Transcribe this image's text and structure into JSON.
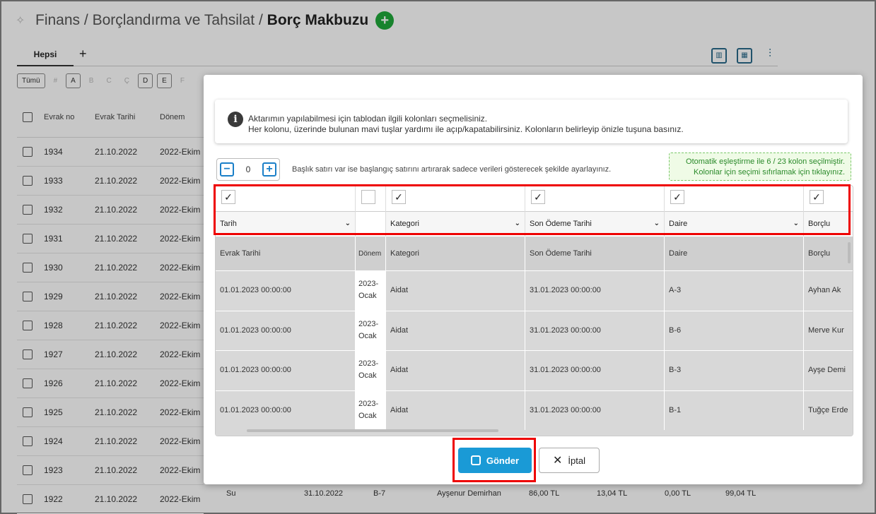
{
  "breadcrumb": {
    "part1": "Finans",
    "sep": "/",
    "part2": "Borçlandırma ve Tahsilat",
    "current": "Borç Makbuzu"
  },
  "tabs": {
    "all": "Hepsi",
    "add": "+"
  },
  "letters": [
    "Tümü",
    "#",
    "A",
    "B",
    "C",
    "Ç",
    "D",
    "E",
    "F"
  ],
  "list": {
    "headers": [
      "Evrak no",
      "Evrak Tarihi",
      "Dönem"
    ],
    "rows": [
      [
        "1934",
        "21.10.2022",
        "2022-Ekim"
      ],
      [
        "1933",
        "21.10.2022",
        "2022-Ekim"
      ],
      [
        "1932",
        "21.10.2022",
        "2022-Ekim"
      ],
      [
        "1931",
        "21.10.2022",
        "2022-Ekim"
      ],
      [
        "1930",
        "21.10.2022",
        "2022-Ekim"
      ],
      [
        "1929",
        "21.10.2022",
        "2022-Ekim"
      ],
      [
        "1928",
        "21.10.2022",
        "2022-Ekim"
      ],
      [
        "1927",
        "21.10.2022",
        "2022-Ekim"
      ],
      [
        "1926",
        "21.10.2022",
        "2022-Ekim"
      ],
      [
        "1925",
        "21.10.2022",
        "2022-Ekim"
      ],
      [
        "1924",
        "21.10.2022",
        "2022-Ekim"
      ],
      [
        "1923",
        "21.10.2022",
        "2022-Ekim"
      ],
      [
        "1922",
        "21.10.2022",
        "2022-Ekim"
      ]
    ],
    "bottom_extra": [
      "Su",
      "31.10.2022",
      "B-7",
      "Ayşenur Demirhan",
      "86,00 TL",
      "13,04 TL",
      "0,00 TL",
      "99,04 TL"
    ]
  },
  "modal": {
    "info_line1": "Aktarımın yapılabilmesi için tablodan ilgili kolonları seçmelisiniz.",
    "info_line2": "Her kolonu, üzerinde bulunan mavi tuşlar yardımı ile açıp/kapatabilirsiniz. Kolonların belirleyip önizle tuşuna basınız.",
    "stepper_value": "0",
    "stepper_hint": "Başlık satırı var ise başlangıç satırını artırarak sadece verileri gösterecek şekilde ayarlayınız.",
    "auto_line1": "Otomatik eşleştirme ile 6 / 23 kolon seçilmiştir.",
    "auto_line2": "Kolonlar için seçimi sıfırlamak için tıklayınız.",
    "mapping": [
      "Tarih",
      "",
      "Kategori",
      "Son Ödeme Tarihi",
      "Daire",
      "Borçlu"
    ],
    "checked": [
      true,
      false,
      true,
      true,
      true,
      true
    ],
    "headers": [
      "Evrak Tarihi",
      "Dönem",
      "Kategori",
      "Son Ödeme Tarihi",
      "Daire",
      "Borçlu"
    ],
    "rows": [
      [
        "01.01.2023 00:00:00",
        "2023-Ocak",
        "Aidat",
        "31.01.2023 00:00:00",
        "A-3",
        "Ayhan Ak"
      ],
      [
        "01.01.2023 00:00:00",
        "2023-Ocak",
        "Aidat",
        "31.01.2023 00:00:00",
        "B-6",
        "Merve Kur"
      ],
      [
        "01.01.2023 00:00:00",
        "2023-Ocak",
        "Aidat",
        "31.01.2023 00:00:00",
        "B-3",
        "Ayşe Demi"
      ],
      [
        "01.01.2023 00:00:00",
        "2023-Ocak",
        "Aidat",
        "31.01.2023 00:00:00",
        "B-1",
        "Tuğçe Erde"
      ]
    ],
    "send_label": "Gönder",
    "cancel_label": "İptal"
  }
}
